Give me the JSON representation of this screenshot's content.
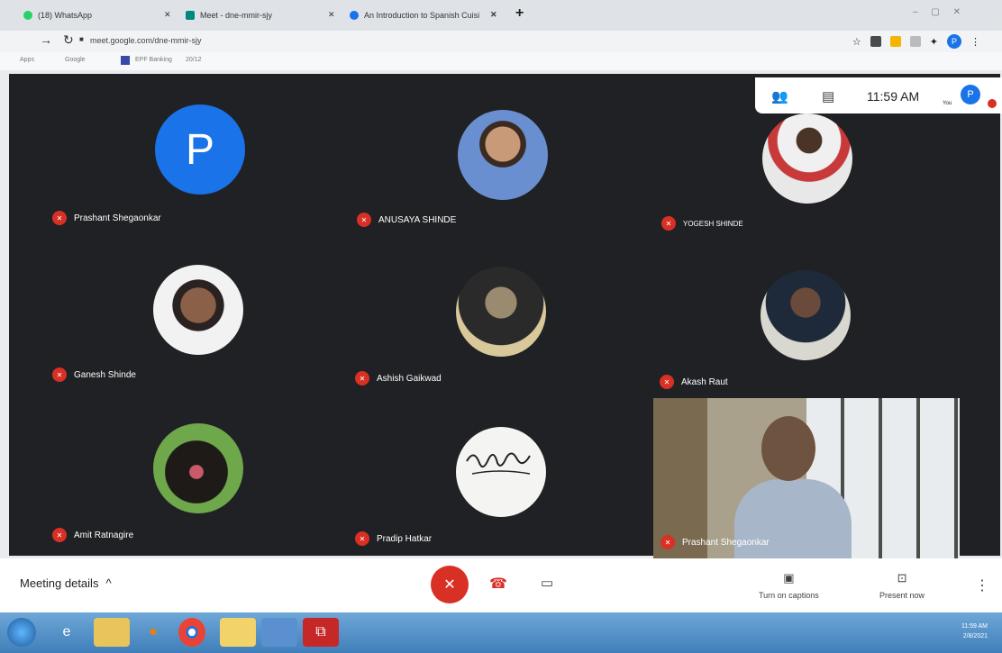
{
  "browser": {
    "tabs": [
      {
        "label": "(18) WhatsApp",
        "favicon_color": "#25d366"
      },
      {
        "label": "Meet - dne-mmir-sjy",
        "favicon_color": "#00897b"
      },
      {
        "label": "An Introduction to Spanish Cuisi",
        "favicon_color": "#1a73e8"
      }
    ],
    "url": "meet.google.com/dne-mmir-sjy",
    "bookmarks": [
      "Apps",
      "Google",
      "EPF Banking",
      "20/12"
    ],
    "profile_initial": "P"
  },
  "meet_header": {
    "time": "11:59 AM",
    "you_label": "You",
    "avatar_initial": "P"
  },
  "participants": [
    {
      "name": "Prashant Shegaonkar",
      "avatar": "letter",
      "initial": "P"
    },
    {
      "name": "ANUSAYA SHINDE",
      "avatar": "photo"
    },
    {
      "name": "YOGESH SHINDE",
      "avatar": "photo"
    },
    {
      "name": "Ganesh Shinde",
      "avatar": "photo"
    },
    {
      "name": "Ashish Gaikwad",
      "avatar": "photo"
    },
    {
      "name": "Akash Raut",
      "avatar": "photo"
    },
    {
      "name": "Amit Ratnagire",
      "avatar": "photo"
    },
    {
      "name": "Pradip Hatkar",
      "avatar": "signature"
    },
    {
      "name": "Prashant Shegaonkar",
      "avatar": "video"
    }
  ],
  "controls": {
    "meeting_details": "Meeting details",
    "captions": "Turn on captions",
    "present": "Present now"
  },
  "taskbar": {
    "time": "11:59 AM",
    "date": "2/8/2021"
  },
  "colors": {
    "stage": "#202124",
    "accent": "#1a73e8",
    "muted": "#d93025"
  }
}
